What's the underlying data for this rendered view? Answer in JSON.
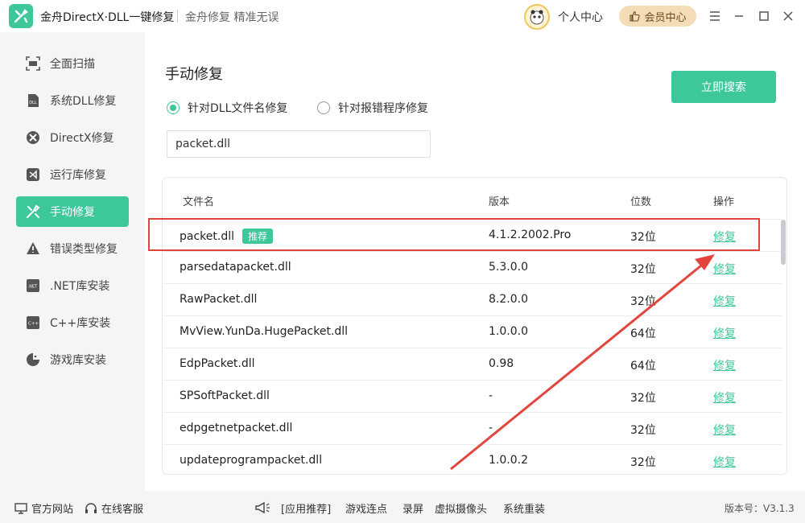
{
  "app": {
    "name": "金舟DirectX·DLL一键修复",
    "slogan": "金舟修复 精准无误",
    "user_center": "个人中心",
    "vip_center": "会员中心"
  },
  "sidebar": {
    "items": [
      {
        "label": "全面扫描",
        "icon": "scan-icon"
      },
      {
        "label": "系统DLL修复",
        "icon": "dll-icon"
      },
      {
        "label": "DirectX修复",
        "icon": "directx-icon"
      },
      {
        "label": "运行库修复",
        "icon": "visual-studio-icon"
      },
      {
        "label": "手动修复",
        "icon": "tools-icon",
        "active": true
      },
      {
        "label": "错误类型修复",
        "icon": "warning-icon"
      },
      {
        "label": ".NET库安装",
        "icon": "dotnet-icon"
      },
      {
        "label": "C++库安装",
        "icon": "cpp-icon"
      },
      {
        "label": "游戏库安装",
        "icon": "game-icon"
      }
    ]
  },
  "main": {
    "title": "手动修复",
    "search_button": "立即搜索",
    "radio_options": [
      {
        "label": "针对DLL文件名修复",
        "checked": true
      },
      {
        "label": "针对报错程序修复",
        "checked": false
      }
    ],
    "search_value": "packet.dll",
    "table": {
      "headers": [
        "文件名",
        "版本",
        "位数",
        "操作"
      ],
      "recommend_badge": "推荐",
      "rows": [
        {
          "name": "packet.dll",
          "version": "4.1.2.2002.Pro",
          "bits": "32位",
          "action": "修复",
          "recommended": true
        },
        {
          "name": "parsedatapacket.dll",
          "version": "5.3.0.0",
          "bits": "32位",
          "action": "修复"
        },
        {
          "name": "RawPacket.dll",
          "version": "8.2.0.0",
          "bits": "32位",
          "action": "修复"
        },
        {
          "name": "MvView.YunDa.HugePacket.dll",
          "version": "1.0.0.0",
          "bits": "64位",
          "action": "修复"
        },
        {
          "name": "EdpPacket.dll",
          "version": "0.98",
          "bits": "64位",
          "action": "修复"
        },
        {
          "name": "SPSoftPacket.dll",
          "version": "-",
          "bits": "32位",
          "action": "修复"
        },
        {
          "name": "edpgetnetpacket.dll",
          "version": "-",
          "bits": "32位",
          "action": "修复"
        },
        {
          "name": "updateprogrampacket.dll",
          "version": "1.0.0.2",
          "bits": "32位",
          "action": "修复"
        }
      ]
    }
  },
  "footer": {
    "official_site": "官方网站",
    "online_service": "在线客服",
    "links": [
      "[应用推荐]",
      "游戏连点",
      "录屏",
      "虚拟摄像头",
      "系统重装"
    ],
    "version": "版本号：V3.1.3"
  },
  "colors": {
    "accent": "#3ec79a",
    "highlight": "#e2453c"
  }
}
